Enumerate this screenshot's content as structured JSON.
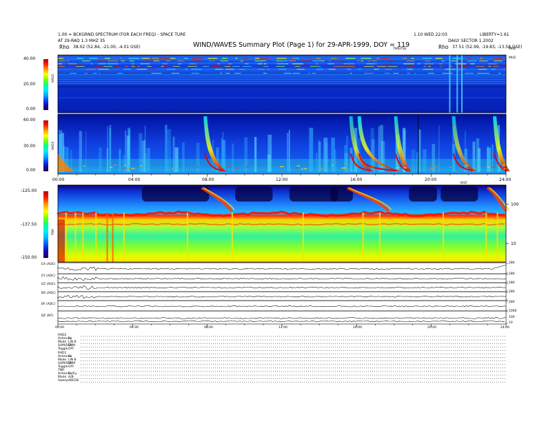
{
  "header": {
    "title": "WIND/WAVES Summary Plot (Page 1) for 29-APR-1999, DOY = 119",
    "left_line1": "1.00 = BCKGRND SPECTRUM (FOR EACH FREQ) - SPACE TURE",
    "left_line2": "AT 29-RAD 1.3 MHZ 35",
    "left_rho_label": "Rho",
    "left_rho_value": "38.02 (52.84, -21.00, -4.01 GSE)",
    "right_line1": "1.10 WED 22:03",
    "right_line1b": "LIBERTY=1.61",
    "right_line2": "DAILY SECTOR 1.2002",
    "right_rho_label": "Rho",
    "right_rho_value": "37.51 (52.99, -19.83, -13.58 GSE)",
    "right_unit": "MHZ",
    "panel_top_mark": "TIMUTSE"
  },
  "panels": {
    "rad2": {
      "name": "RAD2",
      "ticks": [
        "40.00",
        "20.00",
        "0.00"
      ],
      "right_label": "MHZ"
    },
    "rad1": {
      "name": "RAD1",
      "ticks": [
        "60.00",
        "30.00",
        "0.00"
      ]
    },
    "tnr": {
      "name": "TNR",
      "ticks": [
        "-125.00",
        "-137.50",
        "-150.00"
      ],
      "right_unit": "KHZ",
      "right_ticks": [
        "100",
        "10"
      ]
    },
    "lines": [
      {
        "label": "EX (ADC)",
        "right_top": "280",
        "right_mid": "140",
        "right_bot": "0"
      },
      {
        "label": "EY (ADC)",
        "right_top": "280",
        "right_mid": "140",
        "right_bot": "0"
      },
      {
        "label": "EZ (ADC)",
        "right_top": "280",
        "right_mid": "140",
        "right_bot": "0"
      },
      {
        "label": "BX (ADC)",
        "right_top": "280",
        "right_mid": "140",
        "right_bot": "0"
      },
      {
        "label": "BY (ADC)",
        "right_top": "280",
        "right_mid": "140",
        "right_bot": "0"
      },
      {
        "label": "BZ (NT)",
        "right_top": "1000",
        "right_mid": "100",
        "right_bot": "10"
      }
    ]
  },
  "time_axis": [
    "00:00",
    "04:00",
    "08:00",
    "12:00",
    "16:00",
    "20:00",
    "24:00"
  ],
  "info_table": [
    {
      "key": "RAD2",
      "val": ""
    },
    {
      "key": "Antenna",
      "val": "Ex"
    },
    {
      "key": "Mode",
      "val": "LIN 8"
    },
    {
      "key": "SUM/SEP",
      "val": "SUM"
    },
    {
      "key": "Toggle",
      "val": "OFF"
    },
    {
      "key": "RAD1",
      "val": ""
    },
    {
      "key": "Antenna",
      "val": "Ex"
    },
    {
      "key": "Mode",
      "val": "LIN 8"
    },
    {
      "key": "SUM/SEP",
      "val": "SUM"
    },
    {
      "key": "Toggle",
      "val": "OFF"
    },
    {
      "key": "TNR",
      "val": ""
    },
    {
      "key": "Antenna",
      "val": "Ex/Ey"
    },
    {
      "key": "Mode",
      "val": "A/B"
    },
    {
      "key": "Sweep",
      "val": "ABCDE"
    }
  ],
  "chart_data": [
    {
      "type": "heatmap",
      "title": "RAD2",
      "xlabel": "",
      "ylabel": "",
      "xlim": [
        0,
        24
      ],
      "ylim": [
        0,
        40
      ],
      "colorbar_ticks": [
        0,
        20,
        40
      ],
      "features": [
        {
          "kind": "burst",
          "x": [
            20.9,
            21.2
          ],
          "y": [
            0,
            40
          ]
        },
        {
          "kind": "burst",
          "x": [
            21.3,
            21.6
          ],
          "y": [
            0,
            40
          ]
        },
        {
          "kind": "band",
          "x": [
            0,
            24
          ],
          "y": [
            30,
            38
          ]
        },
        {
          "kind": "band",
          "x": [
            0,
            24
          ],
          "y": [
            18.5,
            19.5
          ]
        }
      ]
    },
    {
      "type": "heatmap",
      "title": "RAD1",
      "xlabel": "",
      "ylabel": "",
      "xlim": [
        0,
        24
      ],
      "ylim": [
        0,
        60
      ],
      "colorbar_ticks": [
        0,
        30,
        60
      ],
      "features": [
        {
          "kind": "type-III burst",
          "x": [
            7.7,
            8.8
          ],
          "y": [
            0,
            60
          ]
        },
        {
          "kind": "type-III burst",
          "x": [
            15.4,
            16.6
          ],
          "y": [
            0,
            60
          ]
        },
        {
          "kind": "type-III burst",
          "x": [
            16.0,
            18.2
          ],
          "y": [
            0,
            40
          ]
        },
        {
          "kind": "type-III burst",
          "x": [
            17.9,
            18.7
          ],
          "y": [
            0,
            60
          ]
        },
        {
          "kind": "type-III burst",
          "x": [
            21.0,
            22.2
          ],
          "y": [
            0,
            60
          ]
        },
        {
          "kind": "type-III burst",
          "x": [
            23.3,
            24.0
          ],
          "y": [
            0,
            50
          ]
        }
      ]
    },
    {
      "type": "heatmap",
      "title": "TNR",
      "xlabel": "",
      "ylabel": "",
      "xlim": [
        0,
        24
      ],
      "ylim": [
        -150,
        -125
      ],
      "colorbar_ticks": [
        -150,
        -137.5,
        -125
      ],
      "features": [
        {
          "kind": "plasma line",
          "x": [
            0,
            24
          ],
          "y_khz": 30
        },
        {
          "kind": "burst",
          "x": [
            15.4,
            18.0
          ],
          "y_khz": [
            30,
            200
          ]
        },
        {
          "kind": "burst",
          "x": [
            7.6,
            9.2
          ],
          "y_khz": [
            30,
            200
          ]
        }
      ]
    },
    {
      "type": "line",
      "title": "",
      "xlabel": "",
      "ylabel": "",
      "xlim": [
        0,
        24
      ],
      "series": [
        {
          "name": "EX (ADC)",
          "baseline": 140
        },
        {
          "name": "EY (ADC)",
          "baseline": 140
        },
        {
          "name": "EZ (ADC)",
          "baseline": 140
        },
        {
          "name": "BX (ADC)",
          "baseline": 140
        },
        {
          "name": "BY (ADC)",
          "baseline": 140
        },
        {
          "name": "BZ (NT)",
          "baseline": 100
        }
      ]
    }
  ]
}
